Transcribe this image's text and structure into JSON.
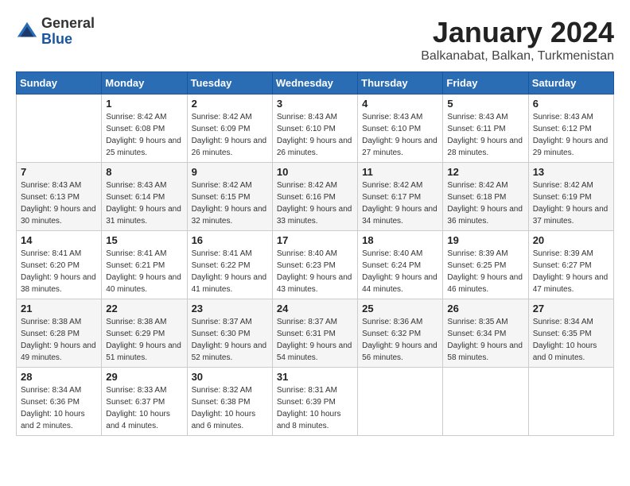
{
  "logo": {
    "general": "General",
    "blue": "Blue"
  },
  "header": {
    "title": "January 2024",
    "subtitle": "Balkanabat, Balkan, Turkmenistan"
  },
  "days_of_week": [
    "Sunday",
    "Monday",
    "Tuesday",
    "Wednesday",
    "Thursday",
    "Friday",
    "Saturday"
  ],
  "weeks": [
    [
      {
        "day": "",
        "sunrise": "",
        "sunset": "",
        "daylight": ""
      },
      {
        "day": "1",
        "sunrise": "Sunrise: 8:42 AM",
        "sunset": "Sunset: 6:08 PM",
        "daylight": "Daylight: 9 hours and 25 minutes."
      },
      {
        "day": "2",
        "sunrise": "Sunrise: 8:42 AM",
        "sunset": "Sunset: 6:09 PM",
        "daylight": "Daylight: 9 hours and 26 minutes."
      },
      {
        "day": "3",
        "sunrise": "Sunrise: 8:43 AM",
        "sunset": "Sunset: 6:10 PM",
        "daylight": "Daylight: 9 hours and 26 minutes."
      },
      {
        "day": "4",
        "sunrise": "Sunrise: 8:43 AM",
        "sunset": "Sunset: 6:10 PM",
        "daylight": "Daylight: 9 hours and 27 minutes."
      },
      {
        "day": "5",
        "sunrise": "Sunrise: 8:43 AM",
        "sunset": "Sunset: 6:11 PM",
        "daylight": "Daylight: 9 hours and 28 minutes."
      },
      {
        "day": "6",
        "sunrise": "Sunrise: 8:43 AM",
        "sunset": "Sunset: 6:12 PM",
        "daylight": "Daylight: 9 hours and 29 minutes."
      }
    ],
    [
      {
        "day": "7",
        "sunrise": "Sunrise: 8:43 AM",
        "sunset": "Sunset: 6:13 PM",
        "daylight": "Daylight: 9 hours and 30 minutes."
      },
      {
        "day": "8",
        "sunrise": "Sunrise: 8:43 AM",
        "sunset": "Sunset: 6:14 PM",
        "daylight": "Daylight: 9 hours and 31 minutes."
      },
      {
        "day": "9",
        "sunrise": "Sunrise: 8:42 AM",
        "sunset": "Sunset: 6:15 PM",
        "daylight": "Daylight: 9 hours and 32 minutes."
      },
      {
        "day": "10",
        "sunrise": "Sunrise: 8:42 AM",
        "sunset": "Sunset: 6:16 PM",
        "daylight": "Daylight: 9 hours and 33 minutes."
      },
      {
        "day": "11",
        "sunrise": "Sunrise: 8:42 AM",
        "sunset": "Sunset: 6:17 PM",
        "daylight": "Daylight: 9 hours and 34 minutes."
      },
      {
        "day": "12",
        "sunrise": "Sunrise: 8:42 AM",
        "sunset": "Sunset: 6:18 PM",
        "daylight": "Daylight: 9 hours and 36 minutes."
      },
      {
        "day": "13",
        "sunrise": "Sunrise: 8:42 AM",
        "sunset": "Sunset: 6:19 PM",
        "daylight": "Daylight: 9 hours and 37 minutes."
      }
    ],
    [
      {
        "day": "14",
        "sunrise": "Sunrise: 8:41 AM",
        "sunset": "Sunset: 6:20 PM",
        "daylight": "Daylight: 9 hours and 38 minutes."
      },
      {
        "day": "15",
        "sunrise": "Sunrise: 8:41 AM",
        "sunset": "Sunset: 6:21 PM",
        "daylight": "Daylight: 9 hours and 40 minutes."
      },
      {
        "day": "16",
        "sunrise": "Sunrise: 8:41 AM",
        "sunset": "Sunset: 6:22 PM",
        "daylight": "Daylight: 9 hours and 41 minutes."
      },
      {
        "day": "17",
        "sunrise": "Sunrise: 8:40 AM",
        "sunset": "Sunset: 6:23 PM",
        "daylight": "Daylight: 9 hours and 43 minutes."
      },
      {
        "day": "18",
        "sunrise": "Sunrise: 8:40 AM",
        "sunset": "Sunset: 6:24 PM",
        "daylight": "Daylight: 9 hours and 44 minutes."
      },
      {
        "day": "19",
        "sunrise": "Sunrise: 8:39 AM",
        "sunset": "Sunset: 6:25 PM",
        "daylight": "Daylight: 9 hours and 46 minutes."
      },
      {
        "day": "20",
        "sunrise": "Sunrise: 8:39 AM",
        "sunset": "Sunset: 6:27 PM",
        "daylight": "Daylight: 9 hours and 47 minutes."
      }
    ],
    [
      {
        "day": "21",
        "sunrise": "Sunrise: 8:38 AM",
        "sunset": "Sunset: 6:28 PM",
        "daylight": "Daylight: 9 hours and 49 minutes."
      },
      {
        "day": "22",
        "sunrise": "Sunrise: 8:38 AM",
        "sunset": "Sunset: 6:29 PM",
        "daylight": "Daylight: 9 hours and 51 minutes."
      },
      {
        "day": "23",
        "sunrise": "Sunrise: 8:37 AM",
        "sunset": "Sunset: 6:30 PM",
        "daylight": "Daylight: 9 hours and 52 minutes."
      },
      {
        "day": "24",
        "sunrise": "Sunrise: 8:37 AM",
        "sunset": "Sunset: 6:31 PM",
        "daylight": "Daylight: 9 hours and 54 minutes."
      },
      {
        "day": "25",
        "sunrise": "Sunrise: 8:36 AM",
        "sunset": "Sunset: 6:32 PM",
        "daylight": "Daylight: 9 hours and 56 minutes."
      },
      {
        "day": "26",
        "sunrise": "Sunrise: 8:35 AM",
        "sunset": "Sunset: 6:34 PM",
        "daylight": "Daylight: 9 hours and 58 minutes."
      },
      {
        "day": "27",
        "sunrise": "Sunrise: 8:34 AM",
        "sunset": "Sunset: 6:35 PM",
        "daylight": "Daylight: 10 hours and 0 minutes."
      }
    ],
    [
      {
        "day": "28",
        "sunrise": "Sunrise: 8:34 AM",
        "sunset": "Sunset: 6:36 PM",
        "daylight": "Daylight: 10 hours and 2 minutes."
      },
      {
        "day": "29",
        "sunrise": "Sunrise: 8:33 AM",
        "sunset": "Sunset: 6:37 PM",
        "daylight": "Daylight: 10 hours and 4 minutes."
      },
      {
        "day": "30",
        "sunrise": "Sunrise: 8:32 AM",
        "sunset": "Sunset: 6:38 PM",
        "daylight": "Daylight: 10 hours and 6 minutes."
      },
      {
        "day": "31",
        "sunrise": "Sunrise: 8:31 AM",
        "sunset": "Sunset: 6:39 PM",
        "daylight": "Daylight: 10 hours and 8 minutes."
      },
      {
        "day": "",
        "sunrise": "",
        "sunset": "",
        "daylight": ""
      },
      {
        "day": "",
        "sunrise": "",
        "sunset": "",
        "daylight": ""
      },
      {
        "day": "",
        "sunrise": "",
        "sunset": "",
        "daylight": ""
      }
    ]
  ]
}
